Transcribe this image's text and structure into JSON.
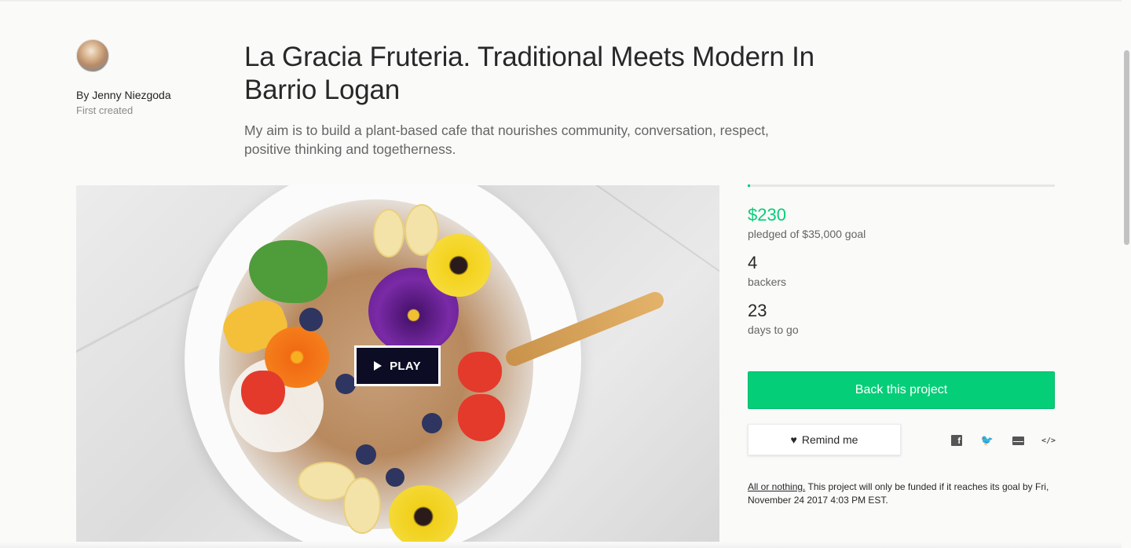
{
  "creator": {
    "by_prefix": "By",
    "name": "Jenny Niezgoda",
    "first_created": "First created"
  },
  "project": {
    "title": "La Gracia Fruteria. Traditional Meets Modern In Barrio Logan",
    "blurb": "My aim is to build a plant-based cafe that nourishes community, conversation, respect, positive thinking and togetherness."
  },
  "video": {
    "play_label": "PLAY"
  },
  "stats": {
    "progress_fraction": 0.0066,
    "pledged": "$230",
    "pledged_label": "pledged of $35,000 goal",
    "backers": "4",
    "backers_label": "backers",
    "days": "23",
    "days_label": "days to go"
  },
  "actions": {
    "back_label": "Back this project",
    "remind_label": "Remind me"
  },
  "share": {
    "facebook_icon": "facebook-icon",
    "twitter_icon": "twitter-icon",
    "email_icon": "email-icon",
    "embed_icon": "embed-icon",
    "embed_glyph": "</>"
  },
  "fine_print": {
    "all_or_nothing": "All or nothing.",
    "text": " This project will only be funded if it reaches its goal by Fri, November 24 2017 4:03 PM EST."
  },
  "colors": {
    "accent_green": "#05ce78",
    "title_text": "#282828",
    "muted_text": "#656565"
  }
}
